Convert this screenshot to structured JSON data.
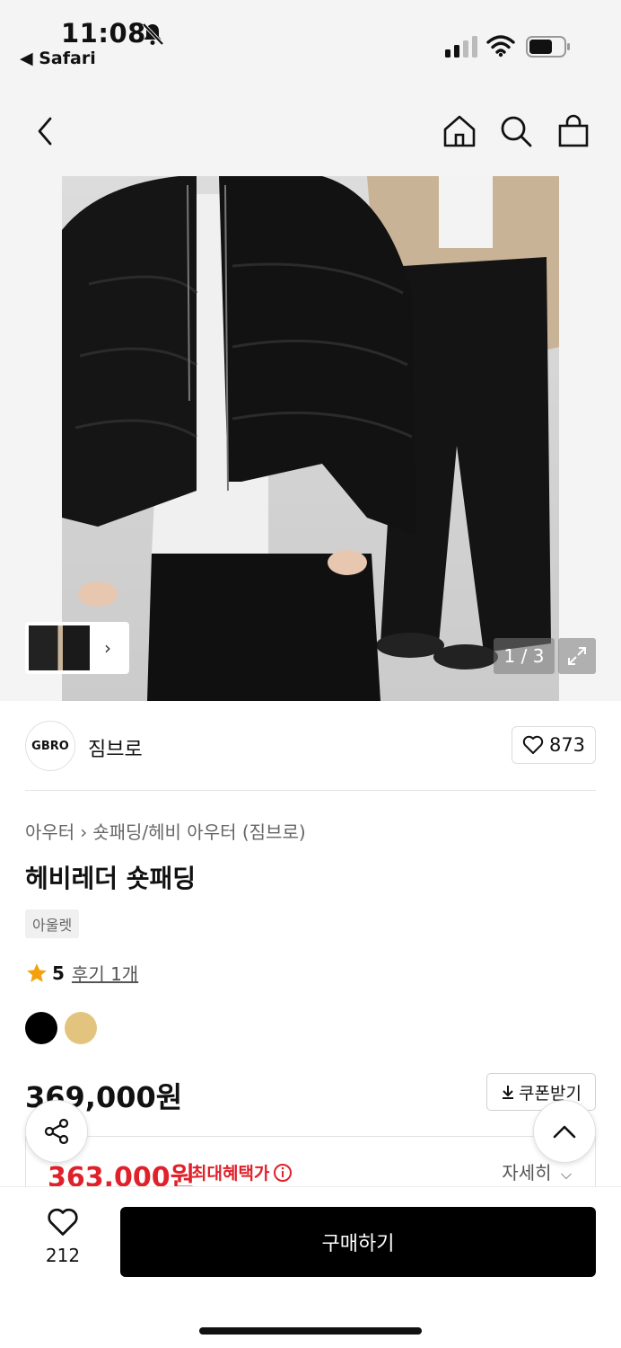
{
  "status": {
    "time": "11:08",
    "back_app": "◀ Safari"
  },
  "product": {
    "pager": "1 / 3",
    "brand": {
      "logo_text": "GBRO",
      "name": "짐브로",
      "likes": "873"
    },
    "breadcrumb": [
      "아우터",
      "숏패딩/헤비 아우터 (짐브로)"
    ],
    "title": "헤비레더 숏패딩",
    "badge": "아울렛",
    "rating": "5",
    "reviews": "후기 1개",
    "colors": [
      "#000000",
      "#e2c47e"
    ],
    "price": "369,000원",
    "coupon_label": "쿠폰받기",
    "benefit_price": "363,000원",
    "benefit_label": "최대혜택가",
    "detail_label": "자세히"
  },
  "bottom": {
    "wish_count": "212",
    "buy_label": "구매하기"
  },
  "colors": {
    "sale_red": "#e0202a",
    "star": "#f2a20c"
  }
}
